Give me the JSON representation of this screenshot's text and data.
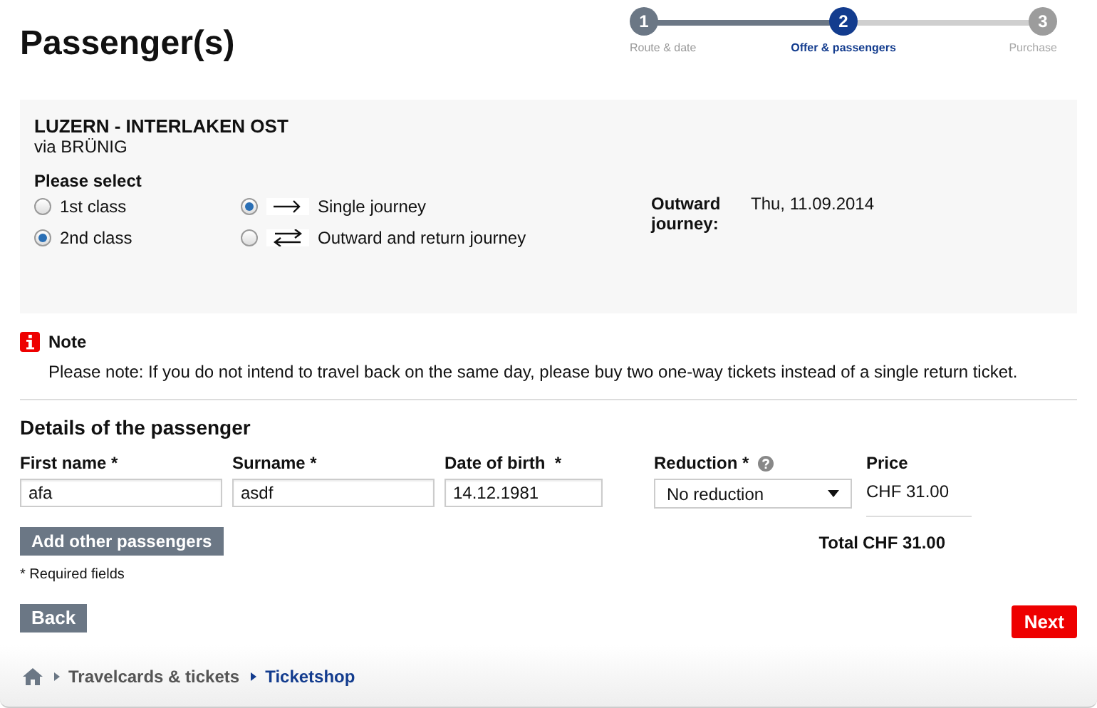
{
  "title": "Passenger(s)",
  "steps": [
    {
      "number": "1",
      "label": "Route & date",
      "kind": "done"
    },
    {
      "number": "2",
      "label": "Offer & passengers",
      "kind": "current"
    },
    {
      "number": "3",
      "label": "Purchase",
      "kind": "upcoming"
    }
  ],
  "route": {
    "name": "LUZERN - INTERLAKEN OST",
    "via": "via BRÜNIG",
    "prompt": "Please select",
    "classes": [
      {
        "label": "1st class",
        "selected": false
      },
      {
        "label": "2nd class",
        "selected": true
      }
    ],
    "journeys": [
      {
        "label": "Single journey",
        "kind": "single",
        "selected": true
      },
      {
        "label": "Outward and return journey",
        "kind": "return",
        "selected": false
      }
    ],
    "outward_label": "Outward journey:",
    "outward_date": "Thu, 11.09.2014"
  },
  "note": {
    "title": "Note",
    "text": "Please note: If you do not intend to travel back on the same day, please buy two one-way tickets instead of a single return ticket."
  },
  "passenger": {
    "heading": "Details of the passenger",
    "first_name": {
      "label": "First name *",
      "value": "afa"
    },
    "surname": {
      "label": "Surname *",
      "value": "asdf"
    },
    "birth": {
      "label": "Date of birth  *",
      "value": "14.12.1981"
    },
    "reduction": {
      "label": "Reduction *",
      "value": "No reduction"
    },
    "price_label": "Price",
    "price": "CHF 31.00",
    "add_button": "Add other passengers",
    "total_label": "Total",
    "total": "CHF 31.00",
    "required_note": "* Required fields"
  },
  "back_button": "Back",
  "next_button": "Next",
  "breadcrumb": [
    "Travelcards & tickets",
    "Ticketshop"
  ]
}
